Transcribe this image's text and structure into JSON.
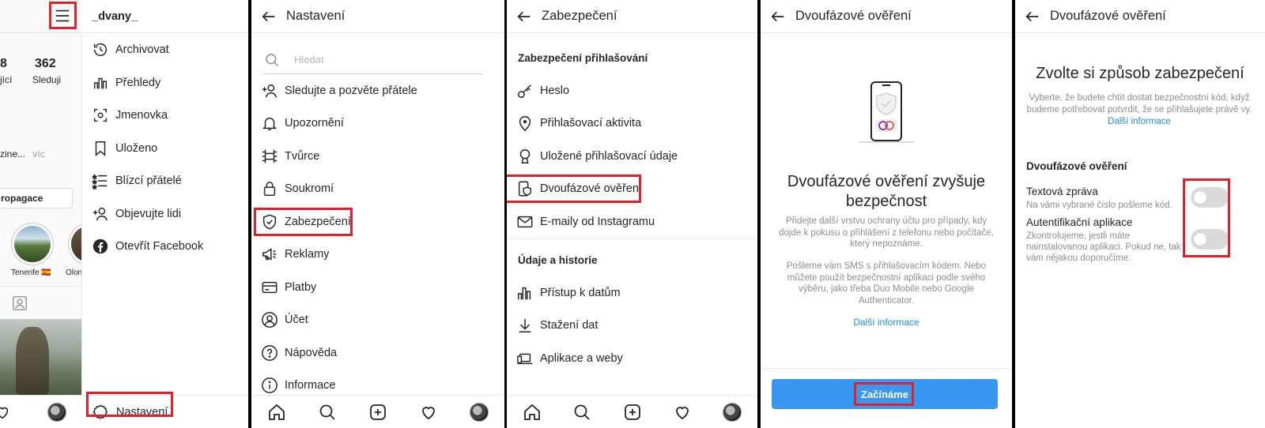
{
  "colors": {
    "accent": "#e0202a",
    "link": "#1e8ad6",
    "primary_button": "#3897f0"
  },
  "panel1": {
    "username": "_dvany_",
    "stats": [
      {
        "count": "8",
        "label": "jící"
      },
      {
        "count": "362",
        "label": "Sleduji"
      }
    ],
    "bio_fragment": "zine...",
    "bio_more": "víc",
    "promo_button": "ropagace",
    "highlights": [
      {
        "label": "Tenerife 🇪🇸"
      },
      {
        "label": "Olon"
      }
    ],
    "menu": [
      {
        "label": "Archivovat",
        "icon": "archive-icon"
      },
      {
        "label": "Přehledy",
        "icon": "insights-icon"
      },
      {
        "label": "Jmenovka",
        "icon": "nametag-icon"
      },
      {
        "label": "Uloženo",
        "icon": "saved-icon"
      },
      {
        "label": "Blízcí přátelé",
        "icon": "close-friends-icon"
      },
      {
        "label": "Objevujte lidi",
        "icon": "discover-people-icon"
      },
      {
        "label": "Otevřít Facebook",
        "icon": "facebook-icon"
      }
    ],
    "settings_label": "Nastavení"
  },
  "panel2": {
    "title": "Nastavení",
    "search_placeholder": "Hledat",
    "items": [
      {
        "label": "Sledujte a pozvěte přátele",
        "icon": "add-person-icon"
      },
      {
        "label": "Upozornění",
        "icon": "bell-icon"
      },
      {
        "label": "Tvůrce",
        "icon": "creator-icon"
      },
      {
        "label": "Soukromí",
        "icon": "lock-icon"
      },
      {
        "label": "Zabezpečení",
        "icon": "shield-icon"
      },
      {
        "label": "Reklamy",
        "icon": "megaphone-icon"
      },
      {
        "label": "Platby",
        "icon": "card-icon"
      },
      {
        "label": "Účet",
        "icon": "account-icon"
      },
      {
        "label": "Nápověda",
        "icon": "help-icon"
      },
      {
        "label": "Informace",
        "icon": "info-icon"
      }
    ]
  },
  "panel3": {
    "title": "Zabezpečení",
    "section1": "Zabezpečení přihlašování",
    "items1": [
      {
        "label": "Heslo",
        "icon": "key-icon"
      },
      {
        "label": "Přihlašovací aktivita",
        "icon": "location-pin-icon"
      },
      {
        "label": "Uložené přihlašovací údaje",
        "icon": "keyhole-icon"
      },
      {
        "label": "Dvoufázové ověření",
        "icon": "phone-shield-icon"
      },
      {
        "label": "E-maily od Instagramu",
        "icon": "mail-icon"
      }
    ],
    "section2": "Údaje a historie",
    "items2": [
      {
        "label": "Přístup k datům",
        "icon": "data-access-icon"
      },
      {
        "label": "Stažení dat",
        "icon": "download-icon"
      },
      {
        "label": "Aplikace a weby",
        "icon": "laptop-icon"
      }
    ]
  },
  "panel4": {
    "title": "Dvoufázové ověření",
    "headline": "Dvoufázové ověření zvyšuje bezpečnost",
    "para1": "Přidejte další vrstvu ochrany účtu pro případy, kdy dojde k pokusu o přihlášení z telefonu nebo počítače, který nepoznáme.",
    "para2": "Pošleme vám SMS s přihlašovacím kódem. Nebo můžete použít bezpečnostní aplikaci podle svého výběru, jako třeba Duo Mobile nebo Google Authenticator.",
    "link": "Další informace",
    "button": "Začínáme"
  },
  "panel5": {
    "title": "Dvoufázové ověření",
    "headline": "Zvolte si způsob zabezpečení",
    "description": "Vyberte, že budete chtít dostat bezpečnostní kód, když budeme potřebovat potvrdit, že se přihlašujete právě vy.",
    "link": "Další informace",
    "section": "Dvoufázové ověření",
    "options": [
      {
        "title": "Textová zpráva",
        "desc": "Na vámi vybrané číslo pošleme kód."
      },
      {
        "title": "Autentifikační aplikace",
        "desc": "Zkontrolujeme, jestli máte nainstalovanou aplikaci. Pokud ne, tak vám nějakou doporučíme."
      }
    ]
  }
}
